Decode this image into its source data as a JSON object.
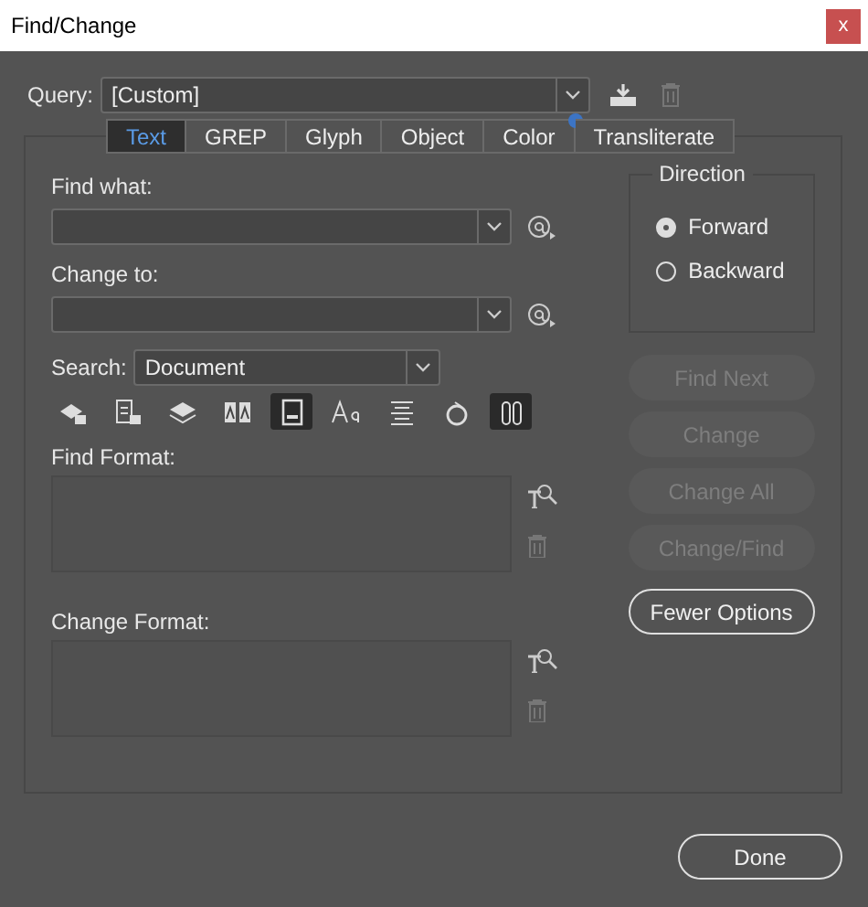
{
  "window": {
    "title": "Find/Change",
    "close": "x"
  },
  "query": {
    "label": "Query:",
    "value": "[Custom]"
  },
  "tabs": [
    {
      "label": "Text",
      "selected": true,
      "dot": false
    },
    {
      "label": "GREP",
      "selected": false,
      "dot": false
    },
    {
      "label": "Glyph",
      "selected": false,
      "dot": false
    },
    {
      "label": "Object",
      "selected": false,
      "dot": false
    },
    {
      "label": "Color",
      "selected": false,
      "dot": true
    },
    {
      "label": "Transliterate",
      "selected": false,
      "dot": false
    }
  ],
  "find_what": {
    "label": "Find what:"
  },
  "change_to": {
    "label": "Change to:"
  },
  "search": {
    "label": "Search:",
    "value": "Document"
  },
  "options": [
    {
      "selected": false
    },
    {
      "selected": false
    },
    {
      "selected": false
    },
    {
      "selected": false
    },
    {
      "selected": true
    },
    {
      "selected": false
    },
    {
      "selected": false
    },
    {
      "selected": false
    },
    {
      "selected": true
    }
  ],
  "find_format": {
    "label": "Find Format:"
  },
  "change_format": {
    "label": "Change Format:"
  },
  "direction": {
    "title": "Direction",
    "options": [
      {
        "label": "Forward",
        "selected": true
      },
      {
        "label": "Backward",
        "selected": false
      }
    ]
  },
  "actions": [
    {
      "label": "Find Next",
      "disabled": true
    },
    {
      "label": "Change",
      "disabled": true
    },
    {
      "label": "Change All",
      "disabled": true
    },
    {
      "label": "Change/Find",
      "disabled": true
    }
  ],
  "more_button": "Fewer Options",
  "done_button": "Done"
}
